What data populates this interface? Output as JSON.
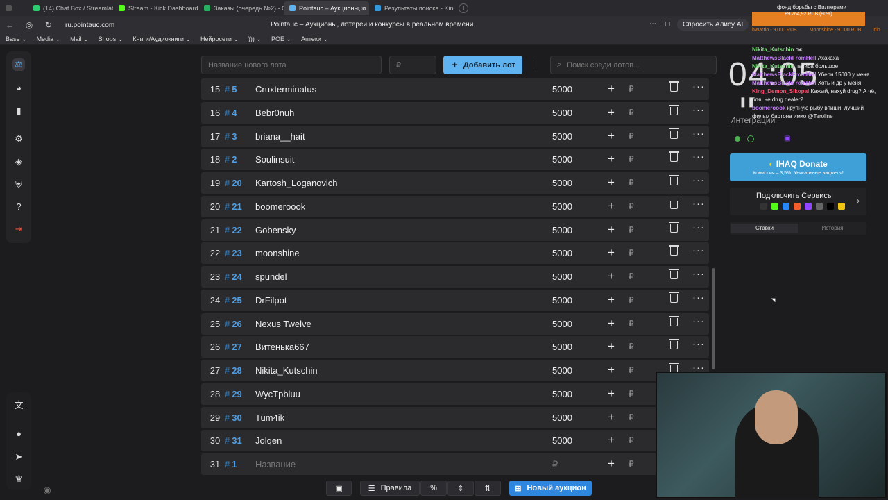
{
  "browser": {
    "tabs": [
      {
        "label": "(14) Chat Box / Streamlab",
        "color": "#2ecc71"
      },
      {
        "label": "Stream - Kick Dashboard",
        "color": "#53fc18"
      },
      {
        "label": "Заказы (очередь №2) - G",
        "color": "#27ae60"
      },
      {
        "label": "Pointauc – Аукционы, л",
        "color": "#5fb3f0"
      },
      {
        "label": "Результаты поиска - Kino",
        "color": "#3498db"
      }
    ],
    "url": "ru.pointauc.com",
    "page_title": "Pointauc – Аукционы, лотереи и конкурсы в реальном времени",
    "alice_label": "Спросить Алису AI",
    "bookmarks": [
      "Base ⌄",
      "Media ⌄",
      "Mail ⌄",
      "Shops ⌄",
      "Книги/Аудиокниги ⌄",
      "Нейросети ⌄",
      "))) ⌄",
      "POE ⌄",
      "Аптеки ⌄"
    ]
  },
  "toolbar": {
    "lot_placeholder": "Название нового лота",
    "amount_placeholder": "₽",
    "add_label": "Добавить лот",
    "search_placeholder": "Поиск среди лотов..."
  },
  "lots": [
    {
      "n": "15",
      "id": "5",
      "name": "Cruxterminatus",
      "amount": "5000"
    },
    {
      "n": "16",
      "id": "4",
      "name": "Bebr0nuh",
      "amount": "5000"
    },
    {
      "n": "17",
      "id": "3",
      "name": "briana__hait",
      "amount": "5000"
    },
    {
      "n": "18",
      "id": "2",
      "name": "Soulinsuit",
      "amount": "5000"
    },
    {
      "n": "19",
      "id": "20",
      "name": "Kartosh_Loganovich",
      "amount": "5000"
    },
    {
      "n": "20",
      "id": "21",
      "name": "boomeroook",
      "amount": "5000"
    },
    {
      "n": "21",
      "id": "22",
      "name": "Gobensky",
      "amount": "5000"
    },
    {
      "n": "22",
      "id": "23",
      "name": "moonshine",
      "amount": "5000"
    },
    {
      "n": "23",
      "id": "24",
      "name": "spundel",
      "amount": "5000"
    },
    {
      "n": "24",
      "id": "25",
      "name": "DrFilpot",
      "amount": "5000"
    },
    {
      "n": "25",
      "id": "26",
      "name": "Nexus Twelve",
      "amount": "5000"
    },
    {
      "n": "26",
      "id": "27",
      "name": "Витенька667",
      "amount": "5000"
    },
    {
      "n": "27",
      "id": "28",
      "name": "Nikita_Kutschin",
      "amount": "5000"
    },
    {
      "n": "28",
      "id": "29",
      "name": "WycTpbluu",
      "amount": "5000"
    },
    {
      "n": "29",
      "id": "30",
      "name": "Tum4ik",
      "amount": "5000"
    },
    {
      "n": "30",
      "id": "31",
      "name": "Jolqen",
      "amount": "5000"
    },
    {
      "n": "31",
      "id": "1",
      "name": "Название",
      "amount": "₽"
    }
  ],
  "row_icons": {
    "hash": "#",
    "plus": "+",
    "ruble": "₽",
    "dots": "···"
  },
  "bottom": {
    "rules": "Правила",
    "percent": "%",
    "new_auction": "Новый аукцион"
  },
  "right": {
    "timer": "04:05",
    "integrations": "Интеграции",
    "donate_title": "IHAQ Donate",
    "donate_sub": "Комиссия – 3,5%. Уникальные виджеты!",
    "services_title": "Подключить Сервисы",
    "tab_bets": "Ставки",
    "tab_history": "История"
  },
  "overlay": {
    "donation_header": "фонд борьбы с Вилтерами",
    "donation_amount": "89 764,92 RUB (90%)",
    "donors": [
      "hWarrio - 9 000 RUB",
      "Moonshine - 9 000 RUB",
      "din"
    ],
    "chat": [
      {
        "user": "Nikita_Kutschin",
        "msg": "пж",
        "color": "#7ee07e"
      },
      {
        "user": "MatthewsBlackFromHell",
        "msg": "Ахахаха",
        "color": "#c77dff"
      },
      {
        "user": "Nikita_Kutschin",
        "msg": "пасиба большое",
        "color": "#7ee07e"
      },
      {
        "user": "MatthewsBlackFromHell",
        "msg": "Уберн 15000 у меня",
        "color": "#c77dff"
      },
      {
        "user": "MatthewsBlackFromHell",
        "msg": "Хоть и др у меня",
        "color": "#c77dff"
      },
      {
        "user": "King_Demon_Sikopal",
        "msg": "Кажый, нахуй drug? А чё, бля, не drug dealer?",
        "color": "#ff4d6d"
      },
      {
        "user": "boomeroook",
        "msg": "крупную рыбу впиши, лучший фильм бартона имхо @Teroline",
        "color": "#c77dff"
      }
    ]
  }
}
